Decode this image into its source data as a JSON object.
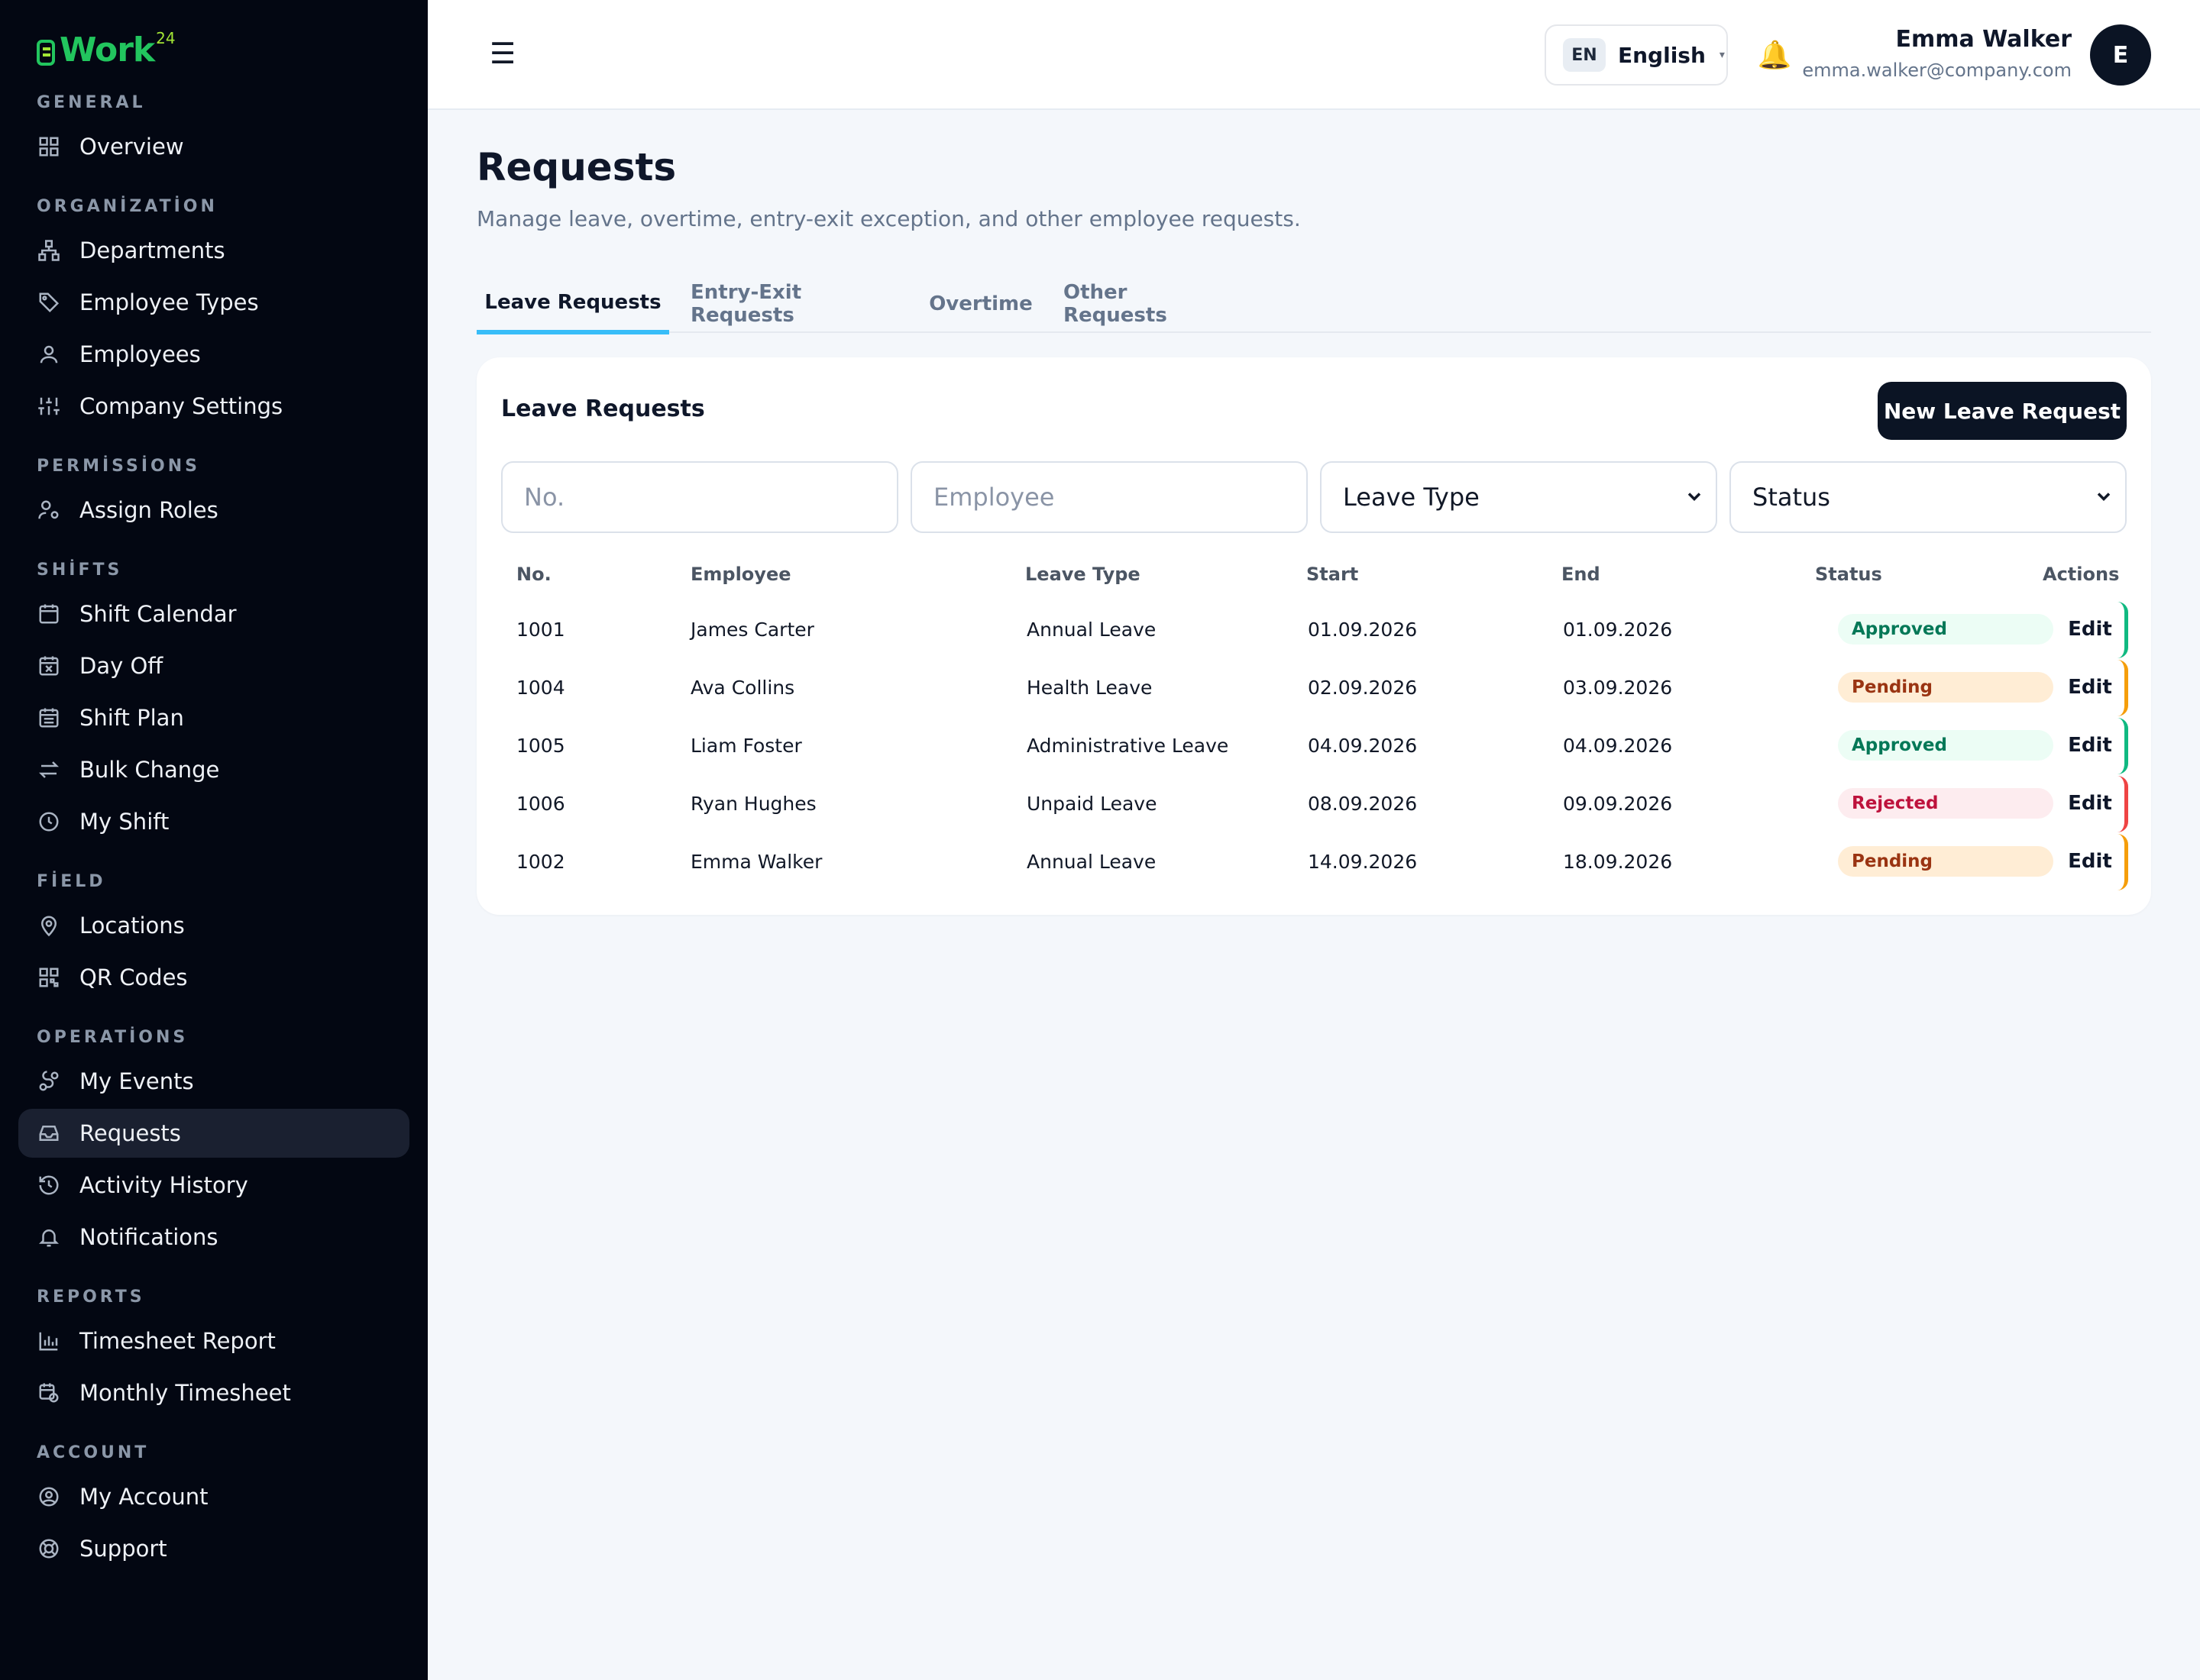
{
  "app": {
    "logo_text": "Work",
    "logo_sup": "24"
  },
  "sidebar": {
    "sections": [
      {
        "title": "GENERAL",
        "items": [
          {
            "label": "Overview",
            "icon": "grid-icon"
          }
        ]
      },
      {
        "title": "ORGANİZATİON",
        "items": [
          {
            "label": "Departments",
            "icon": "sitemap-icon"
          },
          {
            "label": "Employee Types",
            "icon": "tag-icon"
          },
          {
            "label": "Employees",
            "icon": "user-icon"
          },
          {
            "label": "Company Settings",
            "icon": "sliders-icon"
          }
        ]
      },
      {
        "title": "PERMİSSİONS",
        "items": [
          {
            "label": "Assign Roles",
            "icon": "user-cog-icon"
          }
        ]
      },
      {
        "title": "SHİFTS",
        "items": [
          {
            "label": "Shift Calendar",
            "icon": "calendar-icon"
          },
          {
            "label": "Day Off",
            "icon": "calendar-x-icon"
          },
          {
            "label": "Shift Plan",
            "icon": "calendar-list-icon"
          },
          {
            "label": "Bulk Change",
            "icon": "arrows-swap-icon"
          },
          {
            "label": "My Shift",
            "icon": "clock-icon"
          }
        ]
      },
      {
        "title": "FİELD",
        "items": [
          {
            "label": "Locations",
            "icon": "map-pin-icon"
          },
          {
            "label": "QR Codes",
            "icon": "qr-code-icon"
          }
        ]
      },
      {
        "title": "OPERATİONS",
        "items": [
          {
            "label": "My Events",
            "icon": "route-icon"
          },
          {
            "label": "Requests",
            "icon": "inbox-icon",
            "active": true
          },
          {
            "label": "Activity History",
            "icon": "history-icon"
          },
          {
            "label": "Notifications",
            "icon": "bell-icon"
          }
        ]
      },
      {
        "title": "REPORTS",
        "items": [
          {
            "label": "Timesheet Report",
            "icon": "bar-chart-icon"
          },
          {
            "label": "Monthly Timesheet",
            "icon": "calendar-clock-icon"
          }
        ]
      },
      {
        "title": "ACCOUNT",
        "items": [
          {
            "label": "My Account",
            "icon": "user-circle-icon"
          },
          {
            "label": "Support",
            "icon": "life-buoy-icon"
          }
        ]
      }
    ]
  },
  "topbar": {
    "menu_icon": "hamburger-icon",
    "language_code": "EN",
    "language_name": "English",
    "user_name": "Emma Walker",
    "user_email": "emma.walker@company.com",
    "avatar_initial": "E"
  },
  "page": {
    "title": "Requests",
    "subtitle": "Manage leave, overtime, entry-exit exception, and other employee requests.",
    "tabs": [
      "Leave Requests",
      "Entry-Exit Requests",
      "Overtime",
      "Other Requests"
    ],
    "active_tab": "Leave Requests"
  },
  "card": {
    "title": "Leave Requests",
    "new_button": "New Leave Request",
    "filters": {
      "no_placeholder": "No.",
      "employee_placeholder": "Employee",
      "leave_type_selected": "Leave Type",
      "status_selected": "Status"
    },
    "columns": [
      "No.",
      "Employee",
      "Leave Type",
      "Start",
      "End",
      "Status",
      "Actions"
    ],
    "action_label": "Edit",
    "rows": [
      {
        "no": "1001",
        "employee": "James Carter",
        "leave_type": "Annual Leave",
        "start": "01.09.2026",
        "end": "01.09.2026",
        "status": "Approved",
        "status_kind": "approved"
      },
      {
        "no": "1004",
        "employee": "Ava Collins",
        "leave_type": "Health Leave",
        "start": "02.09.2026",
        "end": "03.09.2026",
        "status": "Pending",
        "status_kind": "pending"
      },
      {
        "no": "1005",
        "employee": "Liam Foster",
        "leave_type": "Administrative Leave",
        "start": "04.09.2026",
        "end": "04.09.2026",
        "status": "Approved",
        "status_kind": "approved"
      },
      {
        "no": "1006",
        "employee": "Ryan Hughes",
        "leave_type": "Unpaid Leave",
        "start": "08.09.2026",
        "end": "09.09.2026",
        "status": "Rejected",
        "status_kind": "rejected"
      },
      {
        "no": "1002",
        "employee": "Emma Walker",
        "leave_type": "Annual Leave",
        "start": "14.09.2026",
        "end": "18.09.2026",
        "status": "Pending",
        "status_kind": "pending"
      }
    ]
  },
  "colors": {
    "sidebar_bg": "#030712",
    "accent_tab": "#38bdf8",
    "approved": "#10b981",
    "pending": "#f59e0b",
    "rejected": "#ef4444",
    "primary_button": "#0b1424"
  }
}
